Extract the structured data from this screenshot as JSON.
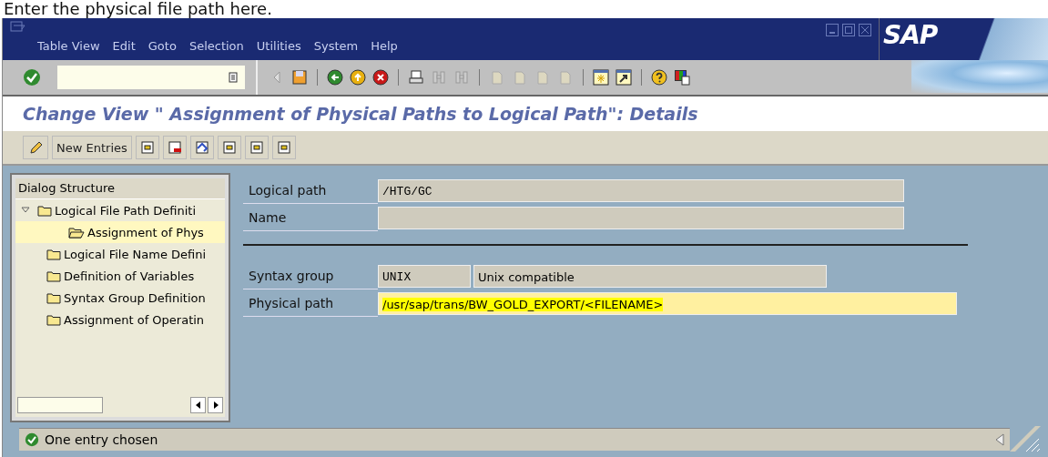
{
  "caption": "Enter the physical file path here.",
  "menu": [
    "Table View",
    "Edit",
    "Goto",
    "Selection",
    "Utilities",
    "System",
    "Help"
  ],
  "logo": "SAP",
  "screen_title": "Change View \" Assignment of Physical Paths to Logical Path\": Details",
  "app_toolbar": {
    "new_entries": "New Entries"
  },
  "tree": {
    "header": "Dialog Structure",
    "items": [
      {
        "label": "Logical File Path Definiti",
        "expanded": true,
        "selected": false,
        "children": [
          {
            "label": "Assignment of Phys",
            "selected": true
          }
        ]
      },
      {
        "label": "Logical File Name Defini",
        "selected": false
      },
      {
        "label": "Definition of Variables",
        "selected": false
      },
      {
        "label": "Syntax Group Definition",
        "selected": false
      },
      {
        "label": "Assignment of Operatin",
        "selected": false
      }
    ]
  },
  "fields": [
    {
      "label": "Logical path",
      "value": "/HTG/GC",
      "kind": "mono"
    },
    {
      "label": "Name",
      "kind": "mono"
    },
    {
      "kind": "divider"
    },
    {
      "label": "Syntax group",
      "value": "UNIX",
      "description": "Unix compatible",
      "kind": "pair"
    },
    {
      "label": "Physical path",
      "value": "/usr/sap/trans/BW_GOLD_EXPORT/<FILENAME>",
      "kind": "input",
      "highlighted": true
    }
  ],
  "status_bar": {
    "message": "One entry chosen"
  }
}
